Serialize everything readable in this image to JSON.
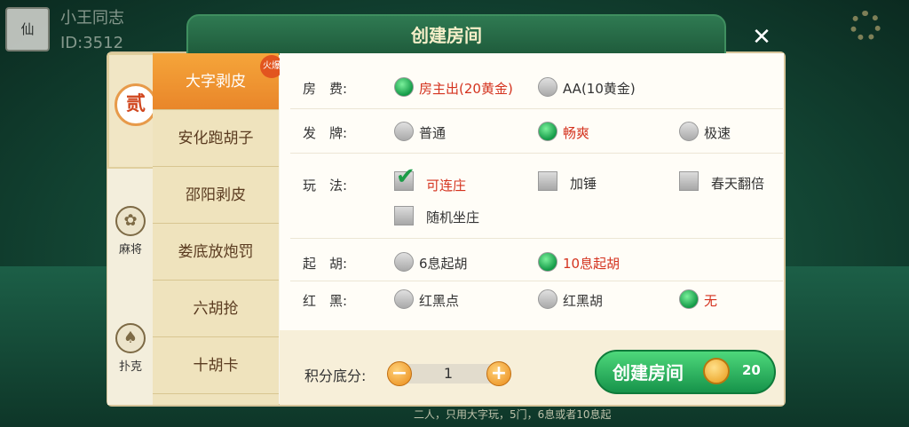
{
  "header": {
    "title": "创建房间",
    "user_name": "小王同志",
    "user_id": "ID:3512"
  },
  "categories": [
    {
      "label": "麻将",
      "icon": "mahjong-icon"
    },
    {
      "label": "扑克",
      "icon": "spade-icon"
    }
  ],
  "active_badge": "贰",
  "games": [
    "大字剥皮",
    "安化跑胡子",
    "邵阳剥皮",
    "娄底放炮罚",
    "六胡抢",
    "十胡卡"
  ],
  "hot_badge": "火爆",
  "options": {
    "fee": {
      "label": "房　费:",
      "choices": [
        "房主出(20黄金)",
        "AA(10黄金)"
      ],
      "selected": 0
    },
    "deal": {
      "label": "发　牌:",
      "choices": [
        "普通",
        "畅爽",
        "极速"
      ],
      "selected": 1
    },
    "play": {
      "label": "玩　法:",
      "choices": [
        "可连庄",
        "加锤",
        "春天翻倍",
        "随机坐庄"
      ],
      "checked": [
        0
      ]
    },
    "hu": {
      "label": "起　胡:",
      "choices": [
        "6息起胡",
        "10息起胡"
      ],
      "selected": 1
    },
    "redblack": {
      "label": "红　黑:",
      "choices": [
        "红黑点",
        "红黑胡",
        "无"
      ],
      "selected": 2
    }
  },
  "score": {
    "label": "积分底分:",
    "value": "1"
  },
  "create": {
    "label": "创建房间",
    "cost": "20"
  },
  "hint": "二人，只用大字玩，5门，6息或者10息起",
  "colors": {
    "accent": "#16934a",
    "selected_text": "#d4331f",
    "tab_active": "#e9862a"
  }
}
